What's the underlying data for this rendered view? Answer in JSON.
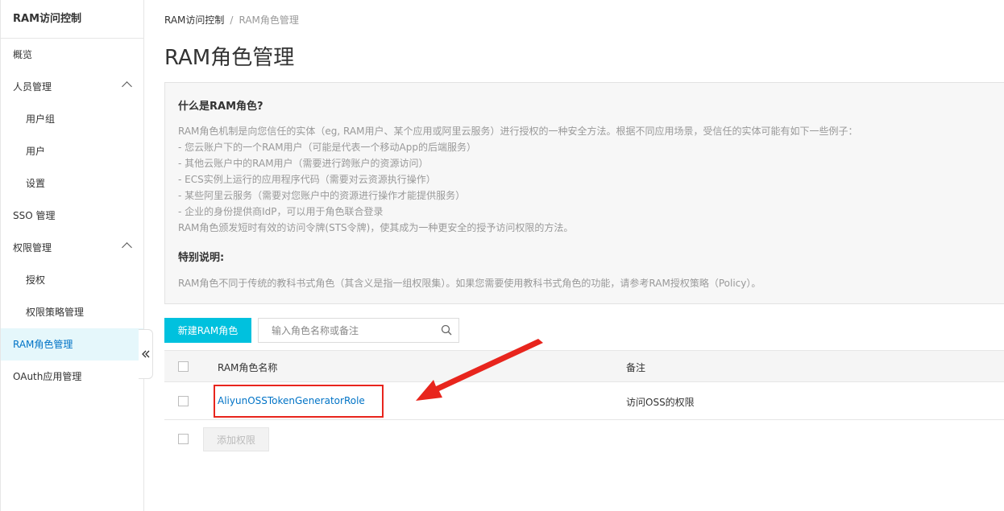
{
  "sidebar": {
    "title": "RAM访问控制",
    "items": [
      {
        "label": "概览"
      },
      {
        "label": "人员管理"
      },
      {
        "label": "用户组"
      },
      {
        "label": "用户"
      },
      {
        "label": "设置"
      },
      {
        "label": "SSO 管理"
      },
      {
        "label": "权限管理"
      },
      {
        "label": "授权"
      },
      {
        "label": "权限策略管理"
      },
      {
        "label": "RAM角色管理"
      },
      {
        "label": "OAuth应用管理"
      }
    ],
    "active_item": "RAM角色管理",
    "collapse_icon": "double-chevron-left-icon"
  },
  "breadcrumb": {
    "root": "RAM访问控制",
    "separator": "/",
    "current": "RAM角色管理"
  },
  "page_title": "RAM角色管理",
  "info": {
    "heading": "什么是RAM角色?",
    "lines": [
      "RAM角色机制是向您信任的实体（eg, RAM用户、某个应用或阿里云服务）进行授权的一种安全方法。根据不同应用场景，受信任的实体可能有如下一些例子：",
      "- 您云账户下的一个RAM用户（可能是代表一个移动App的后端服务）",
      "- 其他云账户中的RAM用户（需要进行跨账户的资源访问）",
      "- ECS实例上运行的应用程序代码（需要对云资源执行操作）",
      "- 某些阿里云服务（需要对您账户中的资源进行操作才能提供服务）",
      "- 企业的身份提供商IdP，可以用于角色联合登录",
      "RAM角色颁发短时有效的访问令牌(STS令牌)，使其成为一种更安全的授予访问权限的方法。"
    ],
    "note_heading": "特别说明:",
    "note": "RAM角色不同于传统的教科书式角色（其含义是指一组权限集）。如果您需要使用教科书式角色的功能，请参考RAM授权策略（Policy）。"
  },
  "toolbar": {
    "create_label": "新建RAM角色",
    "search_placeholder": "输入角色名称或备注",
    "search_value": ""
  },
  "table": {
    "columns": [
      "RAM角色名称",
      "备注"
    ],
    "rows": [
      {
        "name": "AliyunOSSTokenGeneratorRole",
        "remark": "访问OSS的权限"
      }
    ],
    "footer_button": "添加权限"
  },
  "colors": {
    "accent": "#00c1de",
    "link": "#0073c6",
    "active_bg": "#e5f7fb",
    "annotation_red": "#e8251d"
  }
}
